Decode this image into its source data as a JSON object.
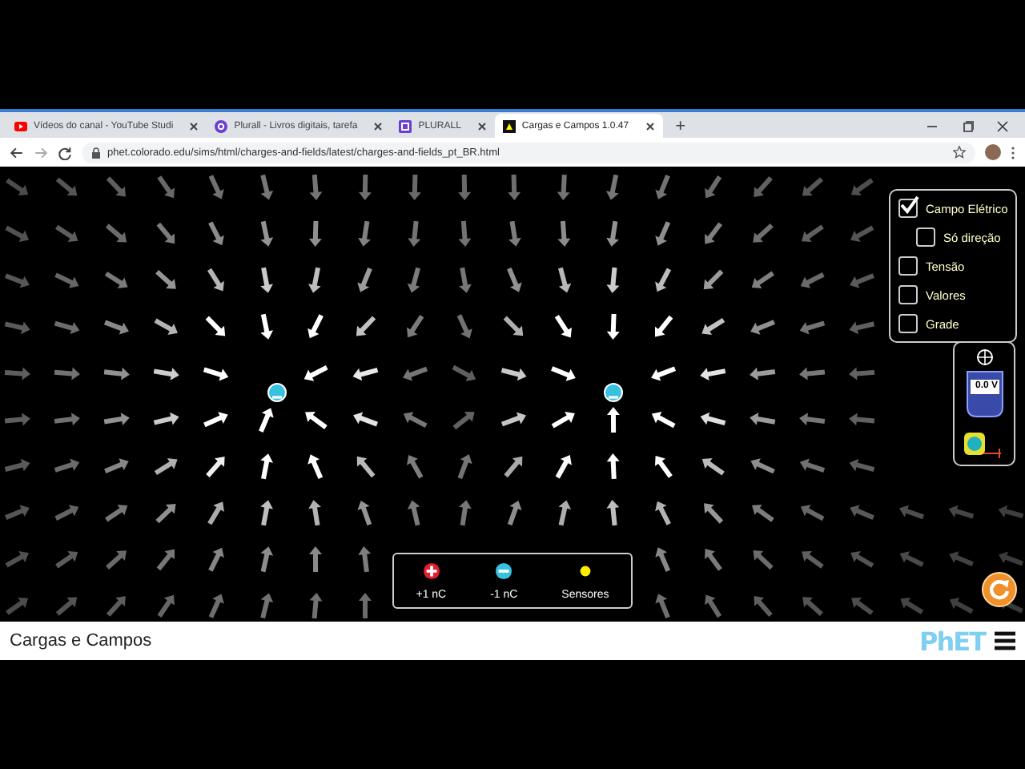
{
  "browser": {
    "tabs": [
      {
        "title": "Vídeos do canal - YouTube Studi",
        "kind": "youtube",
        "selected": false
      },
      {
        "title": "Plurall - Livros digitais, tarefa",
        "kind": "plurall-circle",
        "selected": false
      },
      {
        "title": "PLURALL",
        "kind": "plurall-square",
        "selected": false
      },
      {
        "title": "Cargas e Campos 1.0.47",
        "kind": "phet",
        "selected": true
      }
    ],
    "new_tab": "+",
    "url": "phet.colorado.edu/sims/html/charges-and-fields/latest/charges-and-fields_pt_BR.html"
  },
  "controls": [
    {
      "label": "Campo Elétrico",
      "checked": true,
      "children": [
        {
          "label": "Só direção",
          "checked": false
        }
      ]
    },
    {
      "label": "Tensão",
      "checked": false
    },
    {
      "label": "Valores",
      "checked": false
    },
    {
      "label": "Grade",
      "checked": false
    }
  ],
  "voltmeter": {
    "reading": "0.0 V"
  },
  "toolbox": [
    {
      "label": "+1 nC",
      "kind": "positive"
    },
    {
      "label": "-1 nC",
      "kind": "negative"
    },
    {
      "label": "Sensores",
      "kind": "sensor"
    }
  ],
  "title_bar": {
    "title": "Cargas e Campos",
    "logo": "PhET"
  }
}
